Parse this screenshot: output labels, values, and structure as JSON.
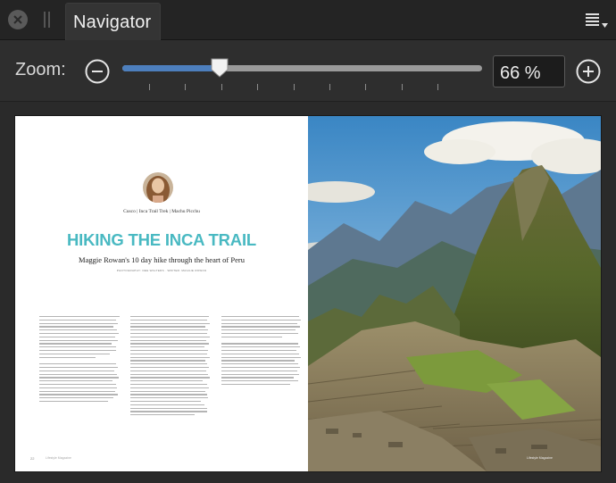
{
  "panel": {
    "tab_label": "Navigator",
    "close_icon": "close-icon",
    "grip_icon": "drag-grip-icon",
    "menu_icon": "panel-menu-icon"
  },
  "zoom": {
    "label": "Zoom:",
    "value_text": "66 %",
    "slider_fraction": 0.27,
    "tick_count": 9,
    "zoom_out_icon": "zoom-out-minus-icon",
    "zoom_in_icon": "zoom-in-plus-icon",
    "accent": "#4d7fbd"
  },
  "document": {
    "meta_line": "Cusco | Inca Trail Trek | Machu Picchu",
    "title": "HIKING THE INCA TRAIL",
    "subtitle": "Maggie Rowan's 10 day hike through the heart of Peru",
    "credit": "PHOTOGRAPHY: DEE WALTERS · WRITER: MAGGIE ROWAN",
    "title_color": "#49b9c2",
    "page_number": "22",
    "running_footer": "Lifestyle Magazine",
    "right_footer": "Lifestyle Magazine"
  }
}
